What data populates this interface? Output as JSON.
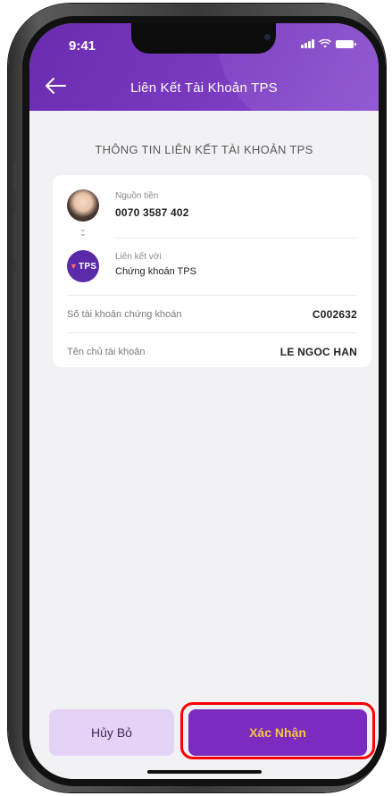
{
  "status_bar": {
    "time": "9:41"
  },
  "header": {
    "back_icon": "arrow-left-icon",
    "title": "Liên Kết Tài Khoản TPS"
  },
  "section_title": "THÔNG TIN LIÊN KẾT TÀI KHOẢN TPS",
  "card": {
    "source_label": "Nguồn tiền",
    "source_value": "0070 3587 402",
    "link_label": "Liên kết với",
    "link_value": "Chứng khoán TPS",
    "tps_logo_text": "TPS",
    "rows": [
      {
        "label": "Số tài khoản chứng khoán",
        "value": "C002632"
      },
      {
        "label": "Tên chủ tài khoản",
        "value": "LE NGOC HAN"
      }
    ]
  },
  "buttons": {
    "cancel_label": "Hủy Bỏ",
    "confirm_label": "Xác Nhận"
  },
  "colors": {
    "header_purple": "#6b2bb0",
    "confirm_bg": "#7b2cbf",
    "confirm_text": "#f5c542",
    "cancel_bg": "#e4d3f7",
    "highlight": "#ff0000"
  }
}
